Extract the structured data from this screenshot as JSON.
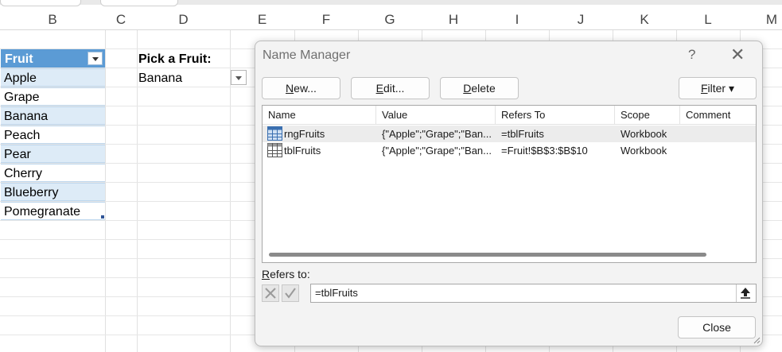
{
  "sheet": {
    "columns": [
      "B",
      "C",
      "D",
      "E",
      "F",
      "G",
      "H",
      "I",
      "J",
      "K",
      "L",
      "M"
    ],
    "table": {
      "header": "Fruit",
      "rows": [
        "Apple",
        "Grape",
        "Banana",
        "Peach",
        "Pear",
        "Cherry",
        "Blueberry",
        "Pomegranate"
      ]
    },
    "pick_label": "Pick a Fruit:",
    "pick_value": "Banana"
  },
  "dialog": {
    "title": "Name Manager",
    "help": "?",
    "close_glyph": "✕",
    "buttons": {
      "new_prefix": "",
      "new_u": "N",
      "new_rest": "ew...",
      "edit_prefix": "",
      "edit_u": "E",
      "edit_rest": "dit...",
      "delete_prefix": "",
      "delete_u": "D",
      "delete_rest": "elete",
      "filter_prefix": "",
      "filter_u": "F",
      "filter_rest": "ilter ▾",
      "close": "Close"
    },
    "list": {
      "headers": [
        "Name",
        "Value",
        "Refers To",
        "Scope",
        "Comment"
      ],
      "rows": [
        {
          "name": "rngFruits",
          "value": "{\"Apple\";\"Grape\";\"Ban...",
          "refers_to": "=tblFruits",
          "scope": "Workbook",
          "comment": "",
          "icon": "named-range-icon"
        },
        {
          "name": "tblFruits",
          "value": "{\"Apple\";\"Grape\";\"Ban...",
          "refers_to": "=Fruit!$B$3:$B$10",
          "scope": "Workbook",
          "comment": "",
          "icon": "table-icon"
        }
      ]
    },
    "refers_to_label_u": "R",
    "refers_to_label_rest": "efers to:",
    "refers_to_value": "=tblFruits"
  },
  "colors": {
    "table_header": "#5b9bd5",
    "table_band": "#ddebf7",
    "dialog_bg": "#f3f3f3"
  }
}
